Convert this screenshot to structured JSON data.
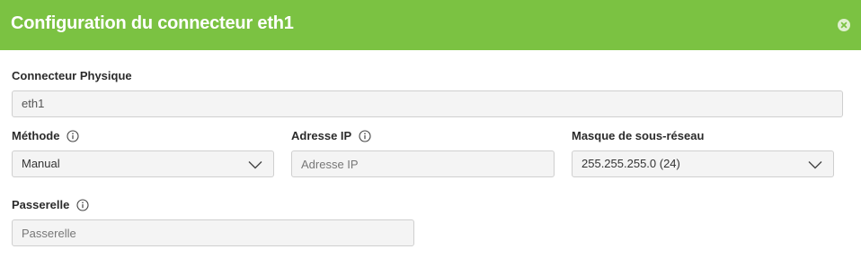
{
  "dialog": {
    "title": "Configuration du connecteur eth1",
    "close_icon": "close-icon"
  },
  "physical_connector": {
    "label": "Connecteur Physique",
    "value": "eth1"
  },
  "method": {
    "label": "Méthode",
    "info_icon": "info-icon",
    "selected": "Manual"
  },
  "ip_address": {
    "label": "Adresse IP",
    "info_icon": "info-icon",
    "value": "",
    "placeholder": "Adresse IP"
  },
  "subnet_mask": {
    "label": "Masque de sous-réseau",
    "selected": "255.255.255.0 (24)"
  },
  "gateway": {
    "label": "Passerelle",
    "info_icon": "info-icon",
    "value": "",
    "placeholder": "Passerelle"
  },
  "colors": {
    "header_bg": "#7bc242",
    "field_bg": "#f4f4f4"
  }
}
